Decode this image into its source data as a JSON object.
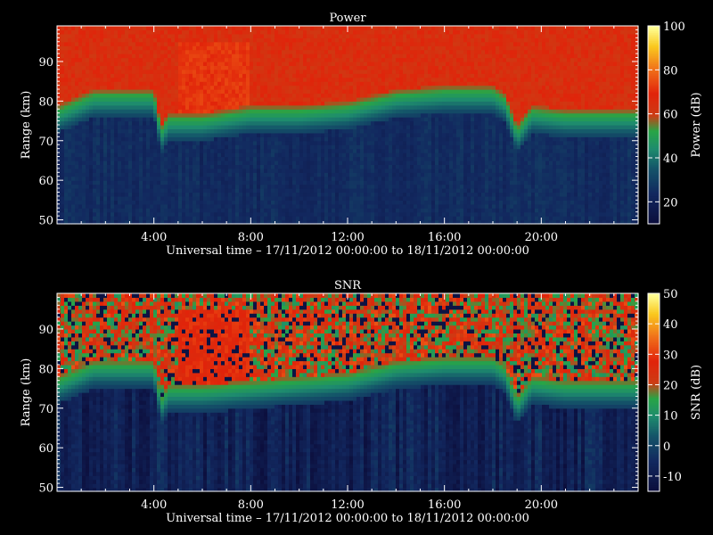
{
  "panels": [
    {
      "title": "Power",
      "ylabel": "Range (km)",
      "xlabel": "Universal time – 17/11/2012 00:00:00 to 18/11/2012 00:00:00",
      "colorbar_label": "Power (dB)",
      "colorbar_ticks": [
        "20",
        "40",
        "60",
        "80",
        "100"
      ]
    },
    {
      "title": "SNR",
      "ylabel": "Range (km)",
      "xlabel": "Universal time – 17/11/2012 00:00:00 to 18/11/2012 00:00:00",
      "colorbar_label": "SNR (dB)",
      "colorbar_ticks": [
        "-10",
        "0",
        "10",
        "20",
        "30",
        "40",
        "50"
      ]
    }
  ],
  "chart_data": [
    {
      "type": "heatmap",
      "title": "Power",
      "xlabel": "Universal time – 17/11/2012 00:00:00 to 18/11/2012 00:00:00",
      "ylabel": "Range (km)",
      "x_ticks": [
        "4:00",
        "8:00",
        "12:00",
        "16:00",
        "20:00"
      ],
      "x_tick_hours": [
        4,
        8,
        12,
        16,
        20
      ],
      "xlim_hours": [
        0,
        24
      ],
      "y_ticks": [
        50,
        60,
        70,
        80,
        90
      ],
      "ylim": [
        49,
        99
      ],
      "colorbar": {
        "label": "Power (dB)",
        "range": [
          10,
          100
        ],
        "ticks": [
          20,
          40,
          60,
          80,
          100
        ]
      },
      "boundary_km": {
        "hours": [
          0,
          1.5,
          4,
          4.3,
          4.6,
          6,
          8,
          10,
          12,
          14,
          16,
          18,
          18.5,
          19,
          19.6,
          21,
          23,
          24
        ],
        "values": [
          75,
          79,
          79,
          70,
          73,
          73,
          75,
          75,
          76,
          79,
          80,
          80,
          78,
          70,
          75,
          74,
          74,
          74
        ]
      },
      "levels_db": {
        "above_boundary": 65,
        "below_boundary": 24,
        "peak": 72
      }
    },
    {
      "type": "heatmap",
      "title": "SNR",
      "xlabel": "Universal time – 17/11/2012 00:00:00 to 18/11/2012 00:00:00",
      "ylabel": "Range (km)",
      "x_ticks": [
        "4:00",
        "8:00",
        "12:00",
        "16:00",
        "20:00"
      ],
      "x_tick_hours": [
        4,
        8,
        12,
        16,
        20
      ],
      "xlim_hours": [
        0,
        24
      ],
      "y_ticks": [
        50,
        60,
        70,
        80,
        90
      ],
      "ylim": [
        49,
        99
      ],
      "colorbar": {
        "label": "SNR (dB)",
        "range": [
          -15,
          50
        ],
        "ticks": [
          -10,
          0,
          10,
          20,
          30,
          40,
          50
        ]
      },
      "boundary_km": {
        "hours": [
          0,
          1.5,
          4,
          4.3,
          4.6,
          6,
          8,
          10,
          12,
          14,
          16,
          18,
          18.5,
          19,
          19.6,
          21,
          23,
          24
        ],
        "values": [
          74,
          78,
          78,
          69,
          72,
          72,
          73,
          74,
          75,
          78,
          79,
          79,
          77,
          69,
          74,
          73,
          73,
          73
        ]
      },
      "levels_db": {
        "above_boundary": 22,
        "below_boundary": -8,
        "peak": 28
      }
    }
  ]
}
